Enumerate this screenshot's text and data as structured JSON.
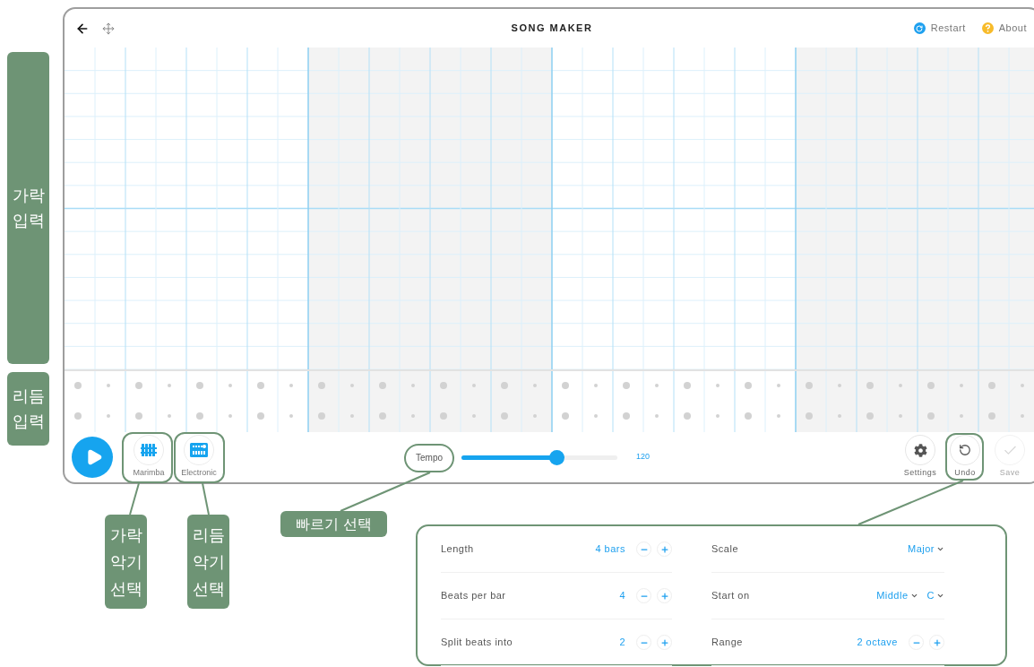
{
  "side_labels": [
    {
      "text": "가락\n입력",
      "kind": "melody"
    },
    {
      "text": "리듬\n입력",
      "kind": "rhythm"
    }
  ],
  "app": {
    "title": "SONG MAKER",
    "header_links": [
      {
        "label": "Restart",
        "kind": "restart"
      },
      {
        "label": "About",
        "kind": "about"
      }
    ],
    "instruments": [
      {
        "label": "Marimba",
        "kind": "marimba"
      },
      {
        "label": "Electronic",
        "kind": "electronic"
      }
    ],
    "tempo": {
      "label": "Tempo",
      "level": 0.61,
      "reading": "120"
    },
    "actions": [
      {
        "label": "Settings",
        "kind": "settings",
        "disabled": false
      },
      {
        "label": "Undo",
        "kind": "undo",
        "disabled": false
      },
      {
        "label": "Save",
        "kind": "save",
        "disabled": true
      }
    ]
  },
  "callouts": [
    {
      "text": "가락\n악기\n선택",
      "kind": "melody-instrument"
    },
    {
      "text": "리듬\n악기\n선택",
      "kind": "rhythm-instrument"
    },
    {
      "text": "빠르기 선택",
      "kind": "tempo"
    }
  ],
  "settings_panel": {
    "columns": [
      [
        {
          "label": "Length",
          "kind": "stepper",
          "values": [
            "4 bars"
          ]
        },
        {
          "label": "Beats per bar",
          "kind": "stepper",
          "values": [
            "4"
          ]
        },
        {
          "label": "Split beats into",
          "kind": "stepper",
          "values": [
            "2"
          ]
        }
      ],
      [
        {
          "label": "Scale",
          "kind": "dropdown",
          "values": [
            "Major"
          ]
        },
        {
          "label": "Start on",
          "kind": "dropdown",
          "values": [
            "Middle",
            "C"
          ]
        },
        {
          "label": "Range",
          "kind": "stepper",
          "values": [
            "2 octave"
          ]
        }
      ]
    ]
  }
}
